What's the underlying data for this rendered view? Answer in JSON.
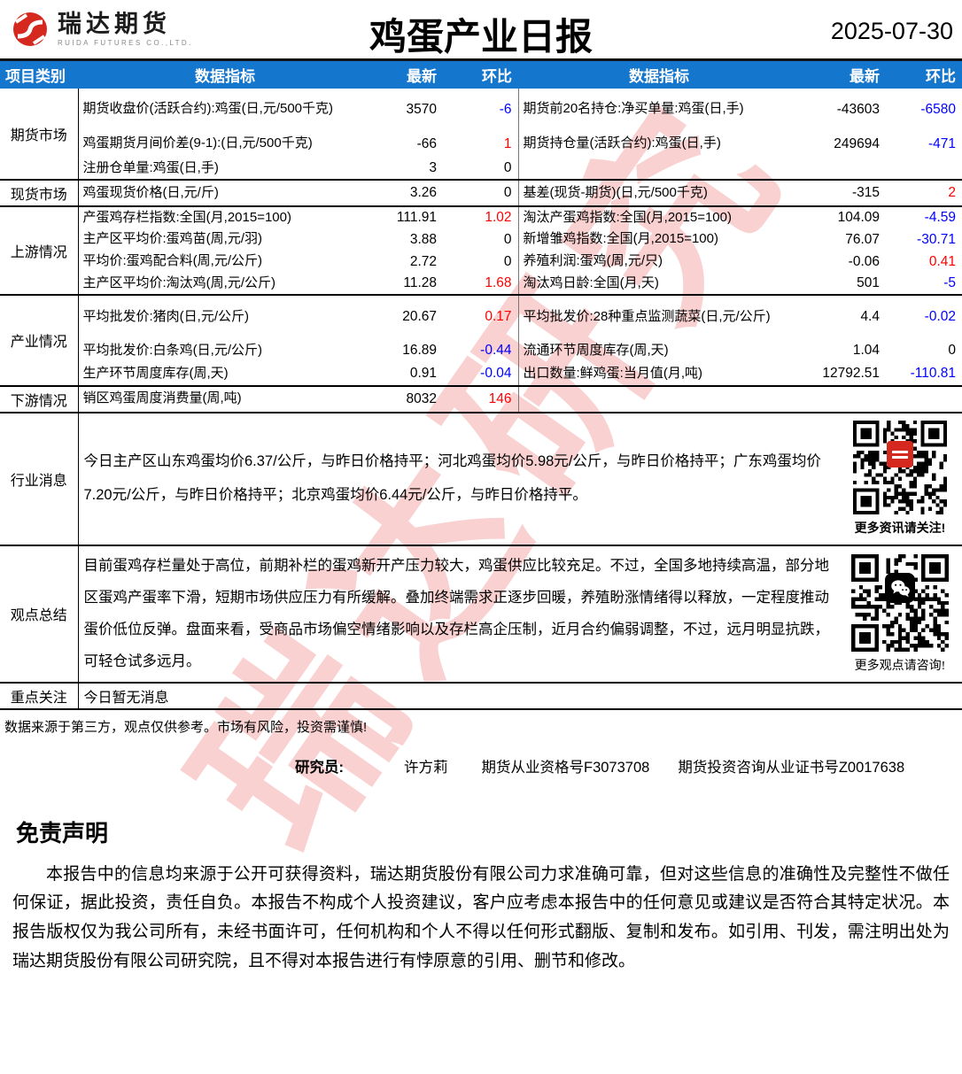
{
  "header": {
    "brand_name": "瑞达期货",
    "brand_subtitle": "RUIDA FUTURES CO.,LTD.",
    "title": "鸡蛋产业日报",
    "date": "2025-07-30"
  },
  "watermark": "瑞达研究",
  "colors": {
    "header_bg": "#1576CE",
    "change_up_red": "#FF0000",
    "change_down_blue": "#0000FF",
    "brand_red": "#D5281E",
    "watermark_pink": "#EE7070"
  },
  "table": {
    "columns": [
      "项目类别",
      "数据指标",
      "最新",
      "环比",
      "数据指标",
      "最新",
      "环比"
    ],
    "sections": [
      {
        "category": "期货市场",
        "rows": [
          {
            "li": "期货收盘价(活跃合约):鸡蛋(日,元/500千克)",
            "lv": "3570",
            "lc": "-6",
            "lcc": "blue",
            "ri": "期货前20名持仓:净买单量:鸡蛋(日,手)",
            "rv": "-43603",
            "rc": "-6580",
            "rcc": "blue"
          },
          {
            "li": "鸡蛋期货月间价差(9-1):(日,元/500千克)",
            "lv": "-66",
            "lc": "1",
            "lcc": "red",
            "ri": "期货持仓量(活跃合约):鸡蛋(日,手)",
            "rv": "249694",
            "rc": "-471",
            "rcc": "blue"
          },
          {
            "li": "注册仓单量:鸡蛋(日,手)",
            "lv": "3",
            "lc": "0",
            "lcc": "black",
            "ri": "",
            "rv": "",
            "rc": "",
            "rcc": "black"
          }
        ]
      },
      {
        "category": "现货市场",
        "rows": [
          {
            "li": "鸡蛋现货价格(日,元/斤)",
            "lv": "3.26",
            "lc": "0",
            "lcc": "black",
            "ri": "基差(现货-期货)(日,元/500千克)",
            "rv": "-315",
            "rc": "2",
            "rcc": "red"
          }
        ]
      },
      {
        "category": "上游情况",
        "rows": [
          {
            "li": "产蛋鸡存栏指数:全国(月,2015=100)",
            "lv": "111.91",
            "lc": "1.02",
            "lcc": "red",
            "ri": "淘汰产蛋鸡指数:全国(月,2015=100)",
            "rv": "104.09",
            "rc": "-4.59",
            "rcc": "blue"
          },
          {
            "li": "主产区平均价:蛋鸡苗(周,元/羽)",
            "lv": "3.88",
            "lc": "0",
            "lcc": "black",
            "ri": "新增雏鸡指数:全国(月,2015=100)",
            "rv": "76.07",
            "rc": "-30.71",
            "rcc": "blue"
          },
          {
            "li": "平均价:蛋鸡配合料(周,元/公斤)",
            "lv": "2.72",
            "lc": "0",
            "lcc": "black",
            "ri": "养殖利润:蛋鸡(周,元/只)",
            "rv": "-0.06",
            "rc": "0.41",
            "rcc": "red"
          },
          {
            "li": "主产区平均价:淘汰鸡(周,元/公斤)",
            "lv": "11.28",
            "lc": "1.68",
            "lcc": "red",
            "ri": "淘汰鸡日龄:全国(月,天)",
            "rv": "501",
            "rc": "-5",
            "rcc": "blue"
          }
        ]
      },
      {
        "category": "产业情况",
        "rows": [
          {
            "li": "平均批发价:猪肉(日,元/公斤)",
            "lv": "20.67",
            "lc": "0.17",
            "lcc": "red",
            "ri": "平均批发价:28种重点监测蔬菜(日,元/公斤)",
            "rv": "4.4",
            "rc": "-0.02",
            "rcc": "blue"
          },
          {
            "li": "平均批发价:白条鸡(日,元/公斤)",
            "lv": "16.89",
            "lc": "-0.44",
            "lcc": "blue",
            "ri": "流通环节周度库存(周,天)",
            "rv": "1.04",
            "rc": "0",
            "rcc": "black"
          },
          {
            "li": "生产环节周度库存(周,天)",
            "lv": "0.91",
            "lc": "-0.04",
            "lcc": "blue",
            "ri": "出口数量:鲜鸡蛋:当月值(月,吨)",
            "rv": "12792.51",
            "rc": "-110.81",
            "rcc": "blue"
          }
        ]
      },
      {
        "category": "下游情况",
        "rows": [
          {
            "li": "销区鸡蛋周度消费量(周,吨)",
            "lv": "8032",
            "lc": "146",
            "lcc": "red",
            "ri": "",
            "rv": "",
            "rc": "",
            "rcc": "black"
          }
        ]
      }
    ],
    "news": {
      "category": "行业消息",
      "text": "今日主产区山东鸡蛋均价6.37/公斤，与昨日价格持平；河北鸡蛋均价5.98元/公斤，与昨日价格持平；广东鸡蛋均价7.20元/公斤，与昨日价格持平；北京鸡蛋均价6.44元/公斤，与昨日价格持平。",
      "qr_icon": "qr-code-red-badge",
      "qr_caption": "更多资讯请关注!"
    },
    "summary": {
      "category": "观点总结",
      "text": "目前蛋鸡存栏量处于高位，前期补栏的蛋鸡新开产压力较大，鸡蛋供应比较充足。不过，全国多地持续高温，部分地区蛋鸡产蛋率下滑，短期市场供应压力有所缓解。叠加终端需求正逐步回暖，养殖盼涨情绪得以释放，一定程度推动蛋价低位反弹。盘面来看，受商品市场偏空情绪影响以及存栏高企压制，近月合约偏弱调整，不过，远月明显抗跌，可轻仓试多远月。",
      "qr_icon": "qr-code-wechat-badge",
      "qr_caption": "更多观点请咨询!"
    },
    "focus": {
      "category": "重点关注",
      "text": "今日暂无消息"
    }
  },
  "footer": {
    "note": "数据来源于第三方，观点仅供参考。市场有风险，投资需谨慎!",
    "researcher_label": "研究员:",
    "researcher_name": "许方莉",
    "cert1": "期货从业资格号F3073708",
    "cert2": "期货投资咨询从业证书号Z0017638"
  },
  "disclaimer": {
    "title": "免责声明",
    "body": "本报告中的信息均来源于公开可获得资料，瑞达期货股份有限公司力求准确可靠，但对这些信息的准确性及完整性不做任何保证，据此投资，责任自负。本报告不构成个人投资建议，客户应考虑本报告中的任何意见或建议是否符合其特定状况。本报告版权仅为我公司所有，未经书面许可，任何机构和个人不得以任何形式翻版、复制和发布。如引用、刊发，需注明出处为瑞达期货股份有限公司研究院，且不得对本报告进行有悖原意的引用、删节和修改。"
  }
}
